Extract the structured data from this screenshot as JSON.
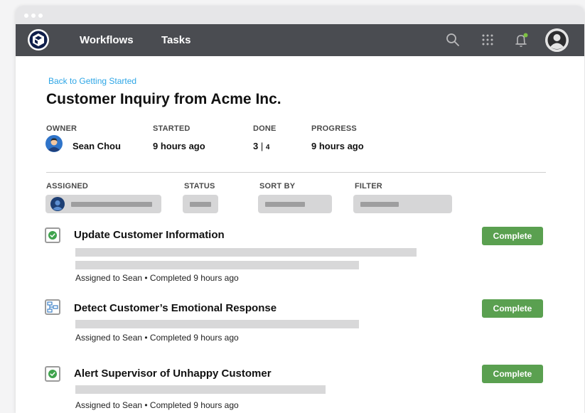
{
  "nav": {
    "items": [
      {
        "label": "Workflows"
      },
      {
        "label": "Tasks"
      }
    ],
    "icons": [
      "search-icon",
      "grid-icon",
      "bell-icon",
      "user-avatar-icon"
    ],
    "notification_dot_color": "#7dc242"
  },
  "page": {
    "back_link": "Back to Getting Started",
    "title": "Customer Inquiry from Acme Inc."
  },
  "meta": {
    "owner_label": "OWNER",
    "owner_value": "Sean Chou",
    "started_label": "STARTED",
    "started_value": "9 hours ago",
    "done_label": "DONE",
    "done_value_main": "3",
    "done_value_sep": "|",
    "done_value_total": "4",
    "progress_label": "PROGRESS",
    "progress_value": "9 hours ago"
  },
  "filters": {
    "assigned_label": "ASSIGNED",
    "status_label": "STATUS",
    "sort_label": "SORT BY",
    "filter_label": "FILTER"
  },
  "tasks": [
    {
      "title": "Update Customer Information",
      "meta": "Assigned to Sean • Completed 9 hours ago",
      "button": "Complete",
      "icon": "check-icon"
    },
    {
      "title": "Detect Customer’s Emotional Response",
      "meta": "Assigned to Sean • Completed 9 hours ago",
      "button": "Complete",
      "icon": "workflow-diagram-icon"
    },
    {
      "title": "Alert Supervisor of Unhappy Customer",
      "meta": "Assigned to Sean • Completed 9 hours ago",
      "button": "Complete",
      "icon": "check-icon"
    }
  ],
  "colors": {
    "nav_bg": "#4a4c51",
    "link": "#2ea6e6",
    "complete_button": "#5aa050",
    "check": "#3fa34d"
  }
}
